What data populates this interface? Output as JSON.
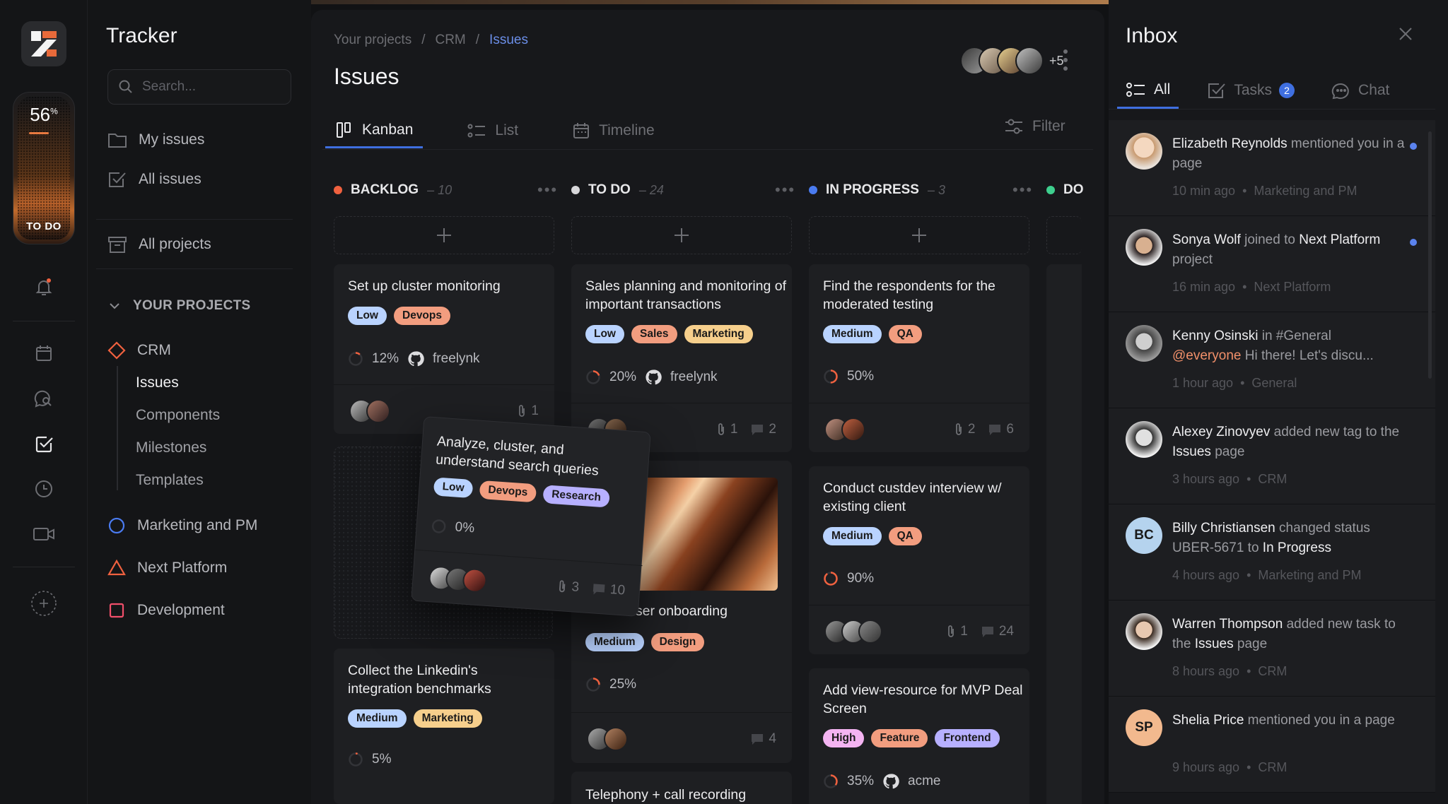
{
  "app": {
    "title": "Tracker"
  },
  "widget": {
    "percent": "56",
    "percent_sign": "%",
    "status": "TO DO"
  },
  "sidebar": {
    "search_placeholder": "Search...",
    "nav": [
      {
        "label": "My issues"
      },
      {
        "label": "All issues"
      },
      {
        "label": "All projects"
      }
    ],
    "projects_heading": "YOUR PROJECTS",
    "projects": [
      {
        "label": "CRM",
        "color": "#f0613f",
        "shape": "diamond"
      },
      {
        "label": "Marketing and PM",
        "color": "#4a7bf0",
        "shape": "circle"
      },
      {
        "label": "Next Platform",
        "color": "#f0613f",
        "shape": "triangle"
      },
      {
        "label": "Development",
        "color": "#f04f6a",
        "shape": "square"
      }
    ],
    "crm_children": [
      "Issues",
      "Components",
      "Milestones",
      "Templates"
    ]
  },
  "header": {
    "breadcrumbs": [
      "Your projects",
      "CRM",
      "Issues"
    ],
    "separator": "/",
    "title": "Issues",
    "members_more": "+5"
  },
  "views": {
    "tabs": [
      "Kanban",
      "List",
      "Timeline"
    ],
    "active": "Kanban",
    "filter_label": "Filter"
  },
  "columns": [
    {
      "name": "BACKLOG",
      "count": "– 10",
      "dot": "#f0613f"
    },
    {
      "name": "TO DO",
      "count": "– 24",
      "dot": "#d7d7da"
    },
    {
      "name": "IN PROGRESS",
      "count": "– 3",
      "dot": "#4a7bf0"
    },
    {
      "name": "DO",
      "dot": "#3ecf8e"
    }
  ],
  "cards": {
    "backlog_1": {
      "title": "Set up cluster monitoring",
      "tags": [
        "Low",
        "Devops"
      ],
      "progress": "12%",
      "repo": "freelynk",
      "attachments": "1"
    },
    "backlog_2": {
      "title": "Collect the Linkedin's integration benchmarks",
      "tags": [
        "Medium",
        "Marketing"
      ],
      "progress": "5%"
    },
    "todo_1": {
      "title": "Sales planning and monitoring of important transactions",
      "tags": [
        "Low",
        "Sales",
        "Marketing"
      ],
      "progress": "20%",
      "repo": "freelynk",
      "attachments": "1",
      "comments": "2"
    },
    "todo_2": {
      "title_partial": "user onboarding",
      "tags": [
        "Medium",
        "Design"
      ],
      "progress": "25%",
      "comments": "4"
    },
    "todo_3": {
      "title": "Telephony + call recording"
    },
    "prog_1": {
      "title": "Find the respondents for the moderated testing",
      "tags": [
        "Medium",
        "QA"
      ],
      "progress": "50%",
      "attachments": "2",
      "comments": "6"
    },
    "prog_2": {
      "title": "Conduct custdev interview w/ existing client",
      "tags": [
        "Medium",
        "QA"
      ],
      "progress": "90%",
      "attachments": "1",
      "comments": "24"
    },
    "prog_3": {
      "title": "Add view-resource for MVP Deal Screen",
      "tags": [
        "High",
        "Feature",
        "Frontend"
      ],
      "progress": "35%",
      "repo": "acme"
    },
    "dragging": {
      "title": "Analyze, cluster, and understand search queries",
      "tags": [
        "Low",
        "Devops",
        "Research"
      ],
      "progress": "0%",
      "attachments": "3",
      "comments": "10"
    }
  },
  "inbox": {
    "title": "Inbox",
    "tabs": [
      {
        "label": "All"
      },
      {
        "label": "Tasks",
        "badge": "2"
      },
      {
        "label": "Chat"
      }
    ],
    "notifications": [
      {
        "name": "Elizabeth Reynolds",
        "rest": " mentioned you in a page",
        "time": "10 min ago",
        "context": "Marketing and PM",
        "unread": true,
        "avatar_color": "#d9b48f"
      },
      {
        "name": "Sonya Wolf",
        "mid": " joined to ",
        "bold2": "Next Platform",
        "rest": " project",
        "time": "16 min ago",
        "context": "Next Platform",
        "unread": true,
        "avatar_color": "#5a4a40"
      },
      {
        "name": "Kenny Osinski",
        "mid": " in #General ",
        "mention": "@everyone",
        "rest": " Hi there! Let's discu...",
        "time": "1 hour ago",
        "context": "General",
        "avatar_color": "#8a8a8a"
      },
      {
        "name": "Alexey Zinovyev",
        "mid": " added new tag to the ",
        "bold2": "Issues",
        "rest": " page",
        "time": "3 hours ago",
        "context": "CRM",
        "avatar_color": "#c8c8c8"
      },
      {
        "name": "Billy Christiansen",
        "mid": " changed status UBER-5671 to ",
        "bold2": "In Progress",
        "time": "4 hours ago",
        "context": "Marketing and PM",
        "initials": "BC",
        "avatar_color": "#b5d3ee"
      },
      {
        "name": "Warren Thompson",
        "mid": " added new task to the ",
        "bold2": "Issues",
        "rest": " page",
        "time": "8 hours ago",
        "context": "CRM",
        "avatar_color": "#d0b8a0"
      },
      {
        "name": "Shelia Price",
        "rest": " mentioned you in a page",
        "time": "9 hours ago",
        "context": "CRM",
        "initials": "SP",
        "avatar_color": "#f2b98e"
      }
    ]
  }
}
